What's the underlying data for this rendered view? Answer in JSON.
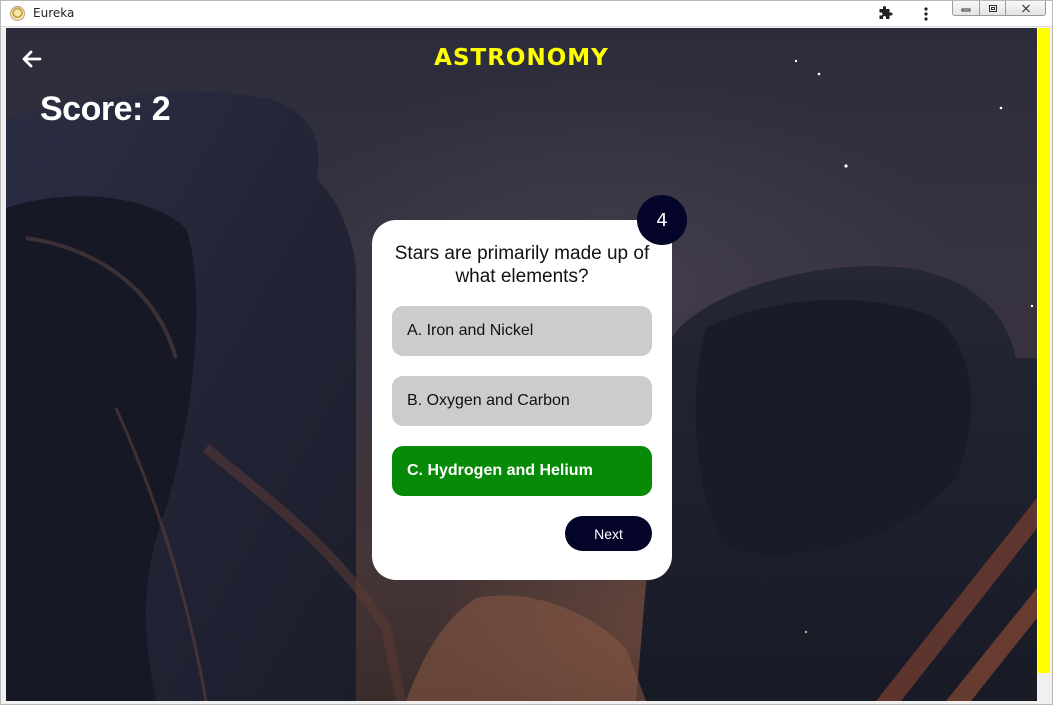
{
  "window": {
    "title": "Eureka"
  },
  "header": {
    "title": "ASTRONOMY",
    "back_icon": "arrow-left-icon"
  },
  "score": {
    "text": "Score: 2"
  },
  "quiz": {
    "question_number": "4",
    "question": "Stars are primarily made up of what elements?",
    "options": [
      {
        "label": "A. Iron and Nickel",
        "state": "default"
      },
      {
        "label": "B. Oxygen and Carbon",
        "state": "default"
      },
      {
        "label": "C. Hydrogen and Helium",
        "state": "correct"
      }
    ],
    "next_label": "Next"
  },
  "colors": {
    "title": "#ffff00",
    "correct": "#078a07",
    "option_default": "#cccccc",
    "dark_navy": "#05052a",
    "scroll_accent": "#ffff00"
  }
}
